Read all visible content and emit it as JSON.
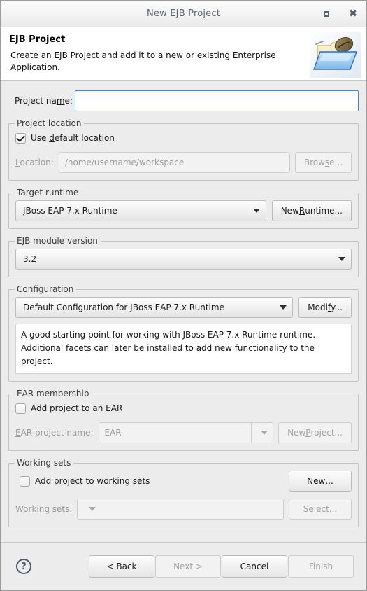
{
  "window": {
    "title": "New EJB Project",
    "maximize_label": "Maximize",
    "close_label": "Close"
  },
  "header": {
    "title": "EJB Project",
    "description": "Create an EJB Project and add it to a new or existing Enterprise Application.",
    "icon": "folder-with-coffee-bean-icon"
  },
  "project_name": {
    "label": "Project name:",
    "value": "",
    "placeholder": ""
  },
  "project_location": {
    "legend": "Project location",
    "use_default_label_pre": "Use ",
    "use_default_label_mnemonic": "d",
    "use_default_label_post": "efault location",
    "use_default_checked": true,
    "location_label_pre": "L",
    "location_label_mnemonic": "",
    "location_label": "Location:",
    "location_value": "/home/username/workspace",
    "browse_label_pre": "Brow",
    "browse_label_mnemonic": "s",
    "browse_label_post": "e...",
    "browse_label": "Browse..."
  },
  "target_runtime": {
    "legend": "Target runtime",
    "selected": "JBoss EAP 7.x Runtime",
    "new_runtime_label_pre": "New ",
    "new_runtime_label_mnemonic": "R",
    "new_runtime_label_post": "untime...",
    "new_runtime_label": "New Runtime..."
  },
  "ejb_module_version": {
    "legend": "EJB module version",
    "selected": "3.2"
  },
  "configuration": {
    "legend": "Configuration",
    "selected": "Default Configuration for JBoss EAP 7.x Runtime",
    "modify_label_pre": "Modi",
    "modify_label_mnemonic": "f",
    "modify_label_post": "y...",
    "modify_label": "Modify...",
    "description": "A good starting point for working with JBoss EAP 7.x Runtime runtime. Additional facets can later be installed to add new functionality to the project."
  },
  "ear_membership": {
    "legend": "EAR membership",
    "add_to_ear_label_pre": "",
    "add_to_ear_label_mnemonic": "A",
    "add_to_ear_label_post": "dd project to an EAR",
    "add_to_ear_checked": false,
    "ear_project_label": "EAR project name:",
    "ear_project_value": "EAR",
    "new_project_label_pre": "New ",
    "new_project_label_mnemonic": "P",
    "new_project_label_post": "roject...",
    "new_project_label": "New Project..."
  },
  "working_sets": {
    "legend": "Working sets",
    "add_to_working_sets_label_pre": "Add proje",
    "add_to_working_sets_label_mnemonic": "c",
    "add_to_working_sets_label_post": "t to working sets",
    "add_to_working_sets_checked": false,
    "working_sets_label": "Working sets:",
    "working_sets_value": "",
    "new_label_pre": "Ne",
    "new_label_mnemonic": "w",
    "new_label_post": "...",
    "new_label": "New...",
    "select_label_pre": "S",
    "select_label_mnemonic": "e",
    "select_label_post": "lect...",
    "select_label": "Select..."
  },
  "footer": {
    "help_label": "?",
    "back_label": "< Back",
    "next_label": "Next >",
    "cancel_label": "Cancel",
    "finish_label": "Finish"
  },
  "colors": {
    "dialog_bg": "#edecec",
    "focus_border": "#3c85d0",
    "title_text": "#58646e",
    "disabled_text": "#9d9d9d",
    "help_icon": "#4a5b6b"
  }
}
